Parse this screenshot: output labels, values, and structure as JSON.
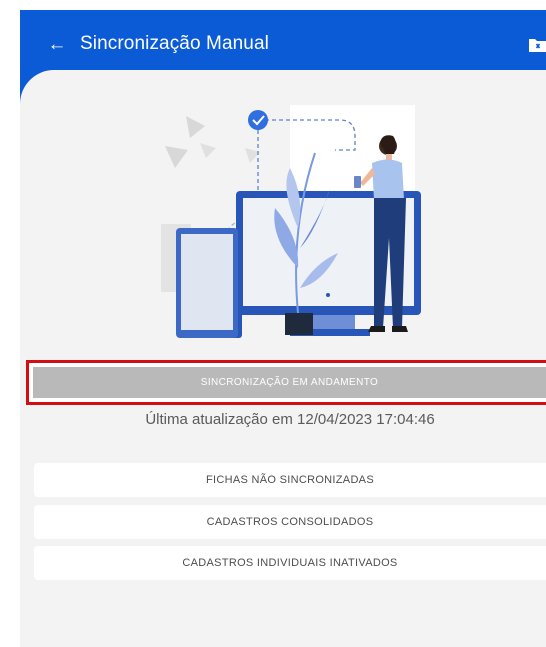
{
  "header": {
    "title": "Sincronização Manual",
    "back_icon": "arrow-left-icon",
    "action_icon": "folder-close-icon",
    "bar_color": "#0b5bd6"
  },
  "sync": {
    "button_label": "SINCRONIZAÇÃO EM ANDAMENTO",
    "last_update": "Última atualização em 12/04/2023 17:04:46"
  },
  "options": [
    {
      "label": "FICHAS NÃO SINCRONIZADAS"
    },
    {
      "label": "CADASTROS CONSOLIDADOS"
    },
    {
      "label": "CADASTROS INDIVIDUAIS INATIVADOS"
    }
  ],
  "colors": {
    "highlight": "#d40d12",
    "disabled_button": "#b9b9b9",
    "background": "#f3f3f3"
  }
}
